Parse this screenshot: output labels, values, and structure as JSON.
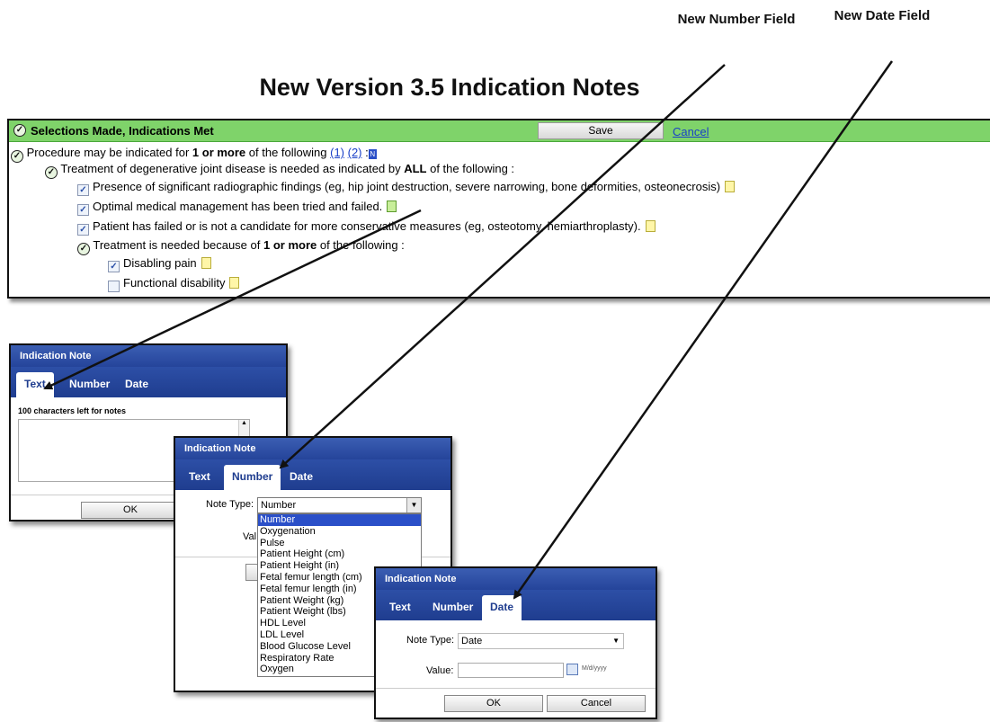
{
  "callouts": {
    "number_field": "New Number Field",
    "date_field": "New Date Field"
  },
  "heading": "New Version 3.5 Indication Notes",
  "main_panel": {
    "header_title": "Selections Made, Indications Met",
    "save_label": "Save",
    "cancel_label": "Cancel",
    "procedure_line": {
      "prefix": "Procedure may be indicated for ",
      "bold": "1 or more",
      "suffix": " of the following ",
      "ref1": "(1)",
      "ref2": "(2)",
      "trail": " :",
      "mini_icon": "N"
    },
    "treatment_line": {
      "prefix": "Treatment of degenerative joint disease is needed as indicated by ",
      "bold": "ALL",
      "suffix": " of the following :"
    },
    "items": [
      {
        "label": "Presence of significant radiographic findings (eg, hip joint destruction, severe narrowing, bone deformities, osteonecrosis)",
        "checked": true,
        "note_icon": "note-icon"
      },
      {
        "label": "Optimal medical management has been tried and failed.",
        "checked": true,
        "note_icon": "note-icon-filled"
      },
      {
        "label": "Patient has failed or is not a candidate for more conservative measures (eg, osteotomy, hemiarthroplasty).",
        "checked": true,
        "note_icon": "note-icon"
      }
    ],
    "reason_line": {
      "prefix": "Treatment is needed because of ",
      "bold": "1 or more",
      "suffix": " of the following :"
    },
    "reasons": [
      {
        "label": "Disabling pain",
        "checked": true
      },
      {
        "label": "Functional disability",
        "checked": false
      }
    ]
  },
  "dialog_text": {
    "title": "Indication Note",
    "tabs": [
      "Text",
      "Number",
      "Date"
    ],
    "active_tab": "Text",
    "chars_left": "100 characters left for notes",
    "ok_label": "OK"
  },
  "dialog_number": {
    "title": "Indication Note",
    "tabs": [
      "Text",
      "Number",
      "Date"
    ],
    "active_tab": "Number",
    "note_type_label": "Note Type:",
    "note_type_value": "Number",
    "value_label_partial": "Val",
    "options": [
      "Number",
      "Oxygenation",
      "Pulse",
      "Patient Height (cm)",
      "Patient Height (in)",
      "Fetal femur length (cm)",
      "Fetal femur length (in)",
      "Patient Weight (kg)",
      "Patient Weight (lbs)",
      "HDL Level",
      "LDL Level",
      "Blood Glucose Level",
      "Respiratory Rate",
      "Oxygen"
    ]
  },
  "dialog_date": {
    "title": "Indication Note",
    "tabs": [
      "Text",
      "Number",
      "Date"
    ],
    "active_tab": "Date",
    "note_type_label": "Note Type:",
    "note_type_value": "Date",
    "value_label": "Value:",
    "date_format": "M/d/yyyy",
    "ok_label": "OK",
    "cancel_label": "Cancel"
  },
  "colors": {
    "header_green": "#7fd36a",
    "dialog_blue": "#25449a",
    "link_blue": "#1a40c8"
  }
}
